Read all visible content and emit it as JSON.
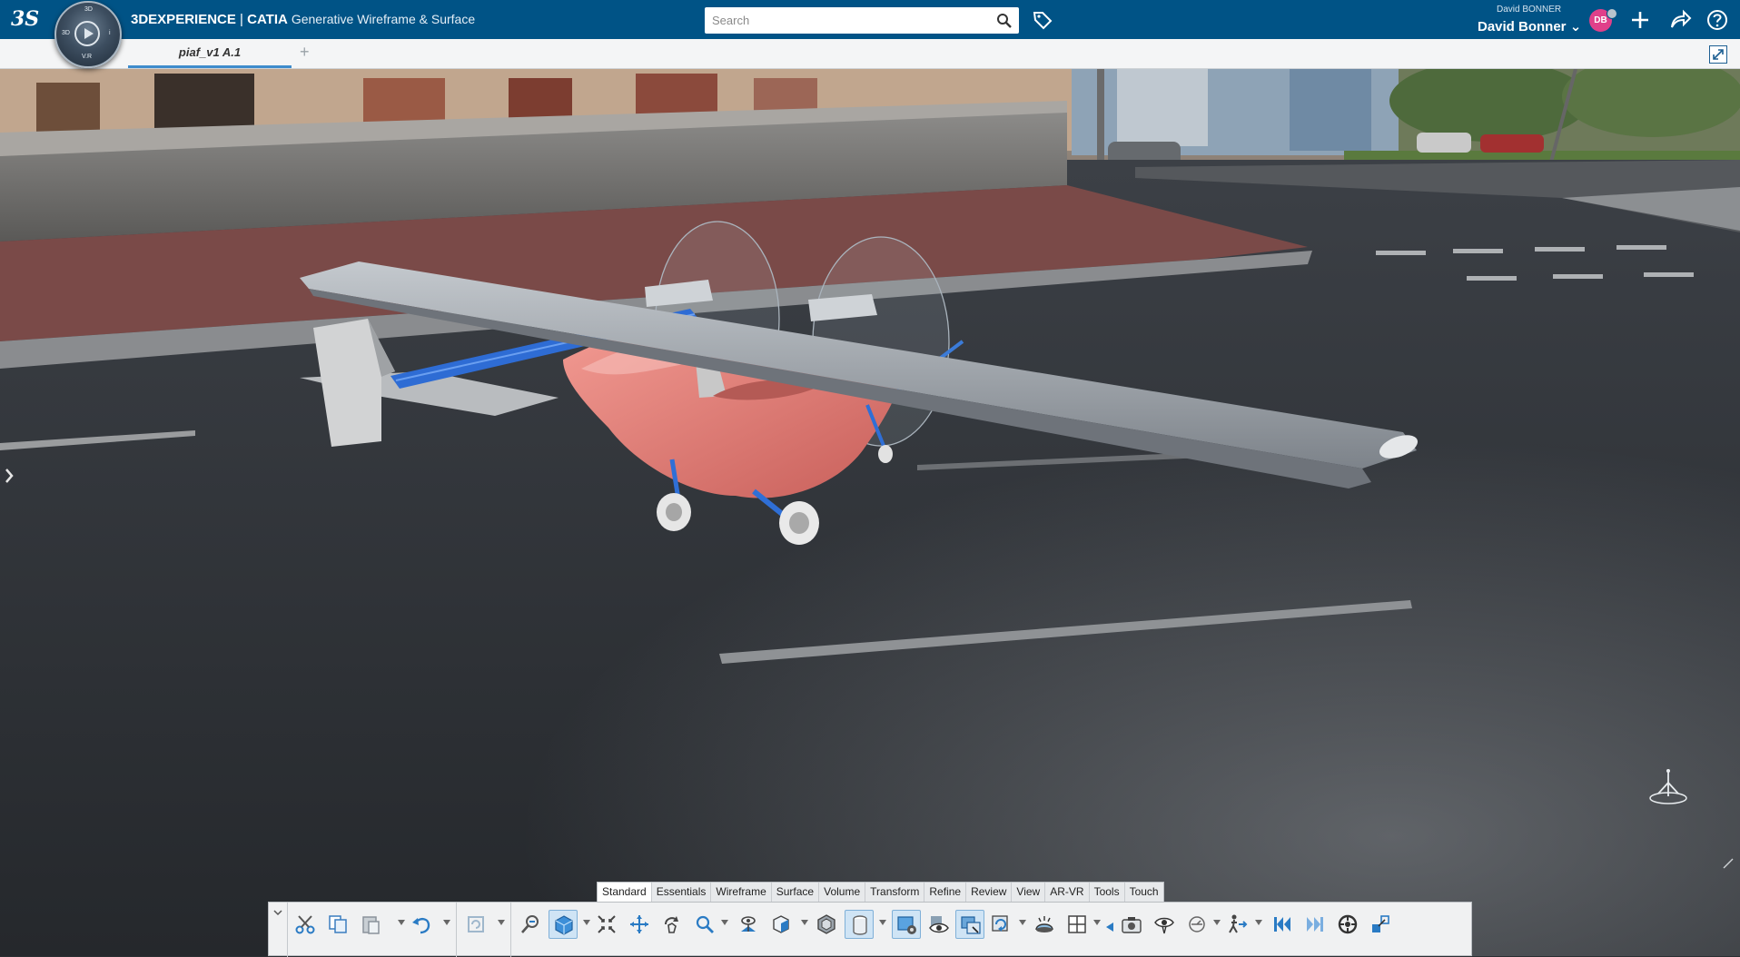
{
  "header": {
    "logo_text": "3S",
    "brand_bold": "3DEXPERIENCE",
    "brand_sep": " | ",
    "brand_product": "CATIA",
    "app_name": "Generative Wireframe & Surface",
    "compass_labels": {
      "top": "3D",
      "left": "3D",
      "right": "i",
      "bottom": "V.R"
    },
    "search": {
      "placeholder": "Search",
      "value": ""
    },
    "user_small": "David BONNER",
    "user_name": "David Bonner",
    "avatar_initials": "DB",
    "icons": [
      "tag-icon",
      "add-icon",
      "share-icon",
      "help-icon"
    ],
    "accent": "#005386"
  },
  "tabs": [
    {
      "label": "piaf_v1 A.1",
      "active": true
    }
  ],
  "tab_add": "+",
  "ribbon": {
    "tabs": [
      {
        "label": "Standard",
        "active": true
      },
      {
        "label": "Essentials"
      },
      {
        "label": "Wireframe"
      },
      {
        "label": "Surface"
      },
      {
        "label": "Volume"
      },
      {
        "label": "Transform"
      },
      {
        "label": "Refine"
      },
      {
        "label": "Review"
      },
      {
        "label": "View"
      },
      {
        "label": "AR-VR"
      },
      {
        "label": "Tools"
      },
      {
        "label": "Touch"
      }
    ],
    "tools": [
      "cut-icon",
      "copy-icon",
      "paste-icon",
      "undo-icon",
      "update-icon",
      "zoom-area-icon",
      "view-cube-icon",
      "fit-all-icon",
      "pan-icon",
      "rotate-icon",
      "zoom-icon",
      "normal-view-icon",
      "isometric-view-icon",
      "shading-icon",
      "cylinder-icon",
      "scene-settings-icon",
      "hide-show-icon",
      "swap-visible-icon",
      "refresh-view-icon",
      "ambiance-icon",
      "split-view-icon",
      "capture-icon",
      "look-at-icon",
      "fly-icon",
      "walk-icon",
      "first-frame-icon",
      "last-frame-icon",
      "settings-wheel-icon",
      "export-icon"
    ]
  },
  "scene": {
    "object": "piaf_v1 ultralight aircraft",
    "fuselage_color": "#e07a74",
    "strut_color": "#2f6fd6",
    "wing_color": "#9aa1a9"
  }
}
